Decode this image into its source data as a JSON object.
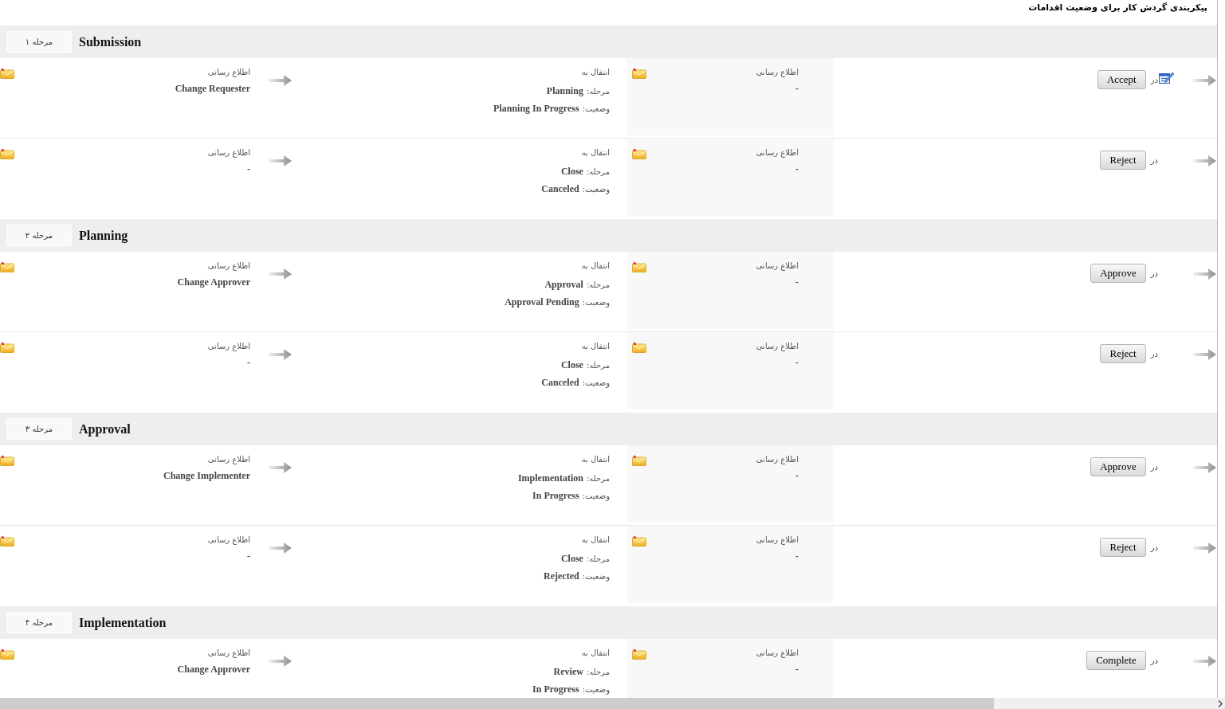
{
  "title": "پیکربندی گردش کار برای وضعیت اقدامات",
  "stages": [
    {
      "badge": "مرحله ۱",
      "name": "Submission",
      "actions": [
        {
          "edit_icon": true,
          "in_label": "در",
          "button": "Accept",
          "notification": {
            "label": "اطلاع رسانی",
            "value": "-"
          },
          "transition": {
            "heading": "انتقال به",
            "stage_label": "مرحله:",
            "stage": "Planning",
            "status_label": "وضعیت:",
            "status": "Planning In Progress"
          },
          "target_notification": {
            "label": "اطلاع رسانی",
            "value": "Change Requester"
          }
        },
        {
          "edit_icon": false,
          "in_label": "در",
          "button": "Reject",
          "notification": {
            "label": "اطلاع رسانی",
            "value": "-"
          },
          "transition": {
            "heading": "انتقال به",
            "stage_label": "مرحله:",
            "stage": "Close",
            "status_label": "وضعیت:",
            "status": "Canceled"
          },
          "target_notification": {
            "label": "اطلاع رسانی",
            "value": "-"
          }
        }
      ]
    },
    {
      "badge": "مرحله ۲",
      "name": "Planning",
      "actions": [
        {
          "edit_icon": false,
          "in_label": "در",
          "button": "Approve",
          "notification": {
            "label": "اطلاع رسانی",
            "value": "-"
          },
          "transition": {
            "heading": "انتقال به",
            "stage_label": "مرحله:",
            "stage": "Approval",
            "status_label": "وضعیت:",
            "status": "Approval Pending"
          },
          "target_notification": {
            "label": "اطلاع رسانی",
            "value": "Change Approver"
          }
        },
        {
          "edit_icon": false,
          "in_label": "در",
          "button": "Reject",
          "notification": {
            "label": "اطلاع رسانی",
            "value": "-"
          },
          "transition": {
            "heading": "انتقال به",
            "stage_label": "مرحله:",
            "stage": "Close",
            "status_label": "وضعیت:",
            "status": "Canceled"
          },
          "target_notification": {
            "label": "اطلاع رسانی",
            "value": "-"
          }
        }
      ]
    },
    {
      "badge": "مرحله ۳",
      "name": "Approval",
      "actions": [
        {
          "edit_icon": false,
          "in_label": "در",
          "button": "Approve",
          "notification": {
            "label": "اطلاع رسانی",
            "value": "-"
          },
          "transition": {
            "heading": "انتقال به",
            "stage_label": "مرحله:",
            "stage": "Implementation",
            "status_label": "وضعیت:",
            "status": "In Progress"
          },
          "target_notification": {
            "label": "اطلاع رسانی",
            "value": "Change Implementer"
          }
        },
        {
          "edit_icon": false,
          "in_label": "در",
          "button": "Reject",
          "notification": {
            "label": "اطلاع رسانی",
            "value": "-"
          },
          "transition": {
            "heading": "انتقال به",
            "stage_label": "مرحله:",
            "stage": "Close",
            "status_label": "وضعیت:",
            "status": "Rejected"
          },
          "target_notification": {
            "label": "اطلاع رسانی",
            "value": "-"
          }
        }
      ]
    },
    {
      "badge": "مرحله ۴",
      "name": "Implementation",
      "actions": [
        {
          "edit_icon": false,
          "in_label": "در",
          "button": "Complete",
          "notification": {
            "label": "اطلاع رسانی",
            "value": "-"
          },
          "transition": {
            "heading": "انتقال به",
            "stage_label": "مرحله:",
            "stage": "Review",
            "status_label": "وضعیت:",
            "status": "In Progress"
          },
          "target_notification": {
            "label": "اطلاع رسانی",
            "value": "Change Approver"
          }
        }
      ]
    }
  ]
}
